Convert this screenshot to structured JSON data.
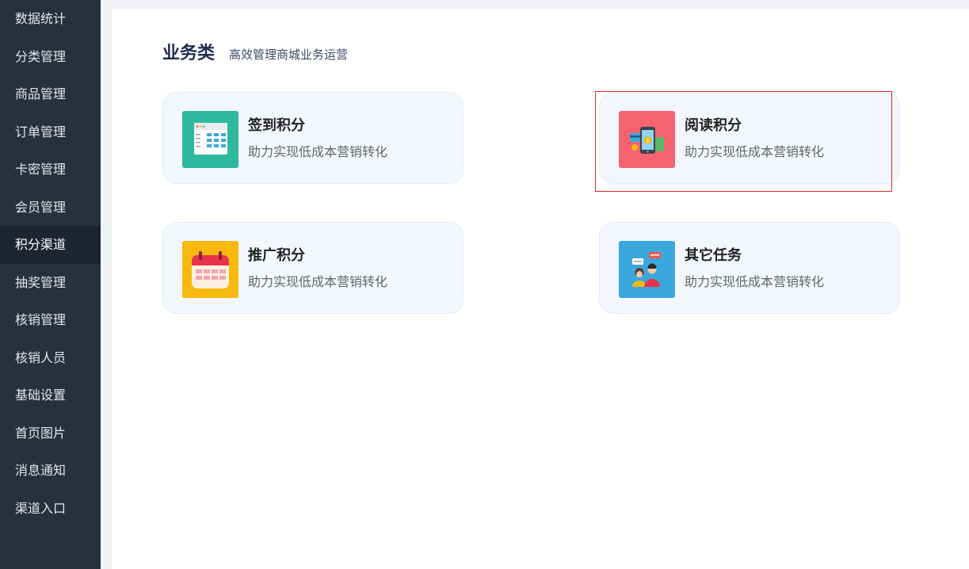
{
  "sidebar": {
    "items": [
      {
        "label": "数据统计"
      },
      {
        "label": "分类管理"
      },
      {
        "label": "商品管理"
      },
      {
        "label": "订单管理"
      },
      {
        "label": "卡密管理"
      },
      {
        "label": "会员管理"
      },
      {
        "label": "积分渠道",
        "active": true
      },
      {
        "label": "抽奖管理"
      },
      {
        "label": "核销管理"
      },
      {
        "label": "核销人员"
      },
      {
        "label": "基础设置"
      },
      {
        "label": "首页图片"
      },
      {
        "label": "消息通知"
      },
      {
        "label": "渠道入口"
      }
    ]
  },
  "section": {
    "title": "业务类",
    "subtitle": "高效管理商城业务运营"
  },
  "cards": [
    {
      "name": "签到积分",
      "desc": "助力实现低成本营销转化",
      "icon": "calendar-grid-icon",
      "color": "#2cb99d"
    },
    {
      "name": "阅读积分",
      "desc": "助力实现低成本营销转化",
      "icon": "phone-payment-icon",
      "color": "#f5636f"
    },
    {
      "name": "推广积分",
      "desc": "助力实现低成本营销转化",
      "icon": "calendar-icon",
      "color": "#f7b90d"
    },
    {
      "name": "其它任务",
      "desc": "助力实现低成本营销转化",
      "icon": "people-chat-icon",
      "color": "#3aa8dc"
    }
  ],
  "colors": {
    "sidebar_bg": "#28303d",
    "highlight": "#e0281f"
  }
}
